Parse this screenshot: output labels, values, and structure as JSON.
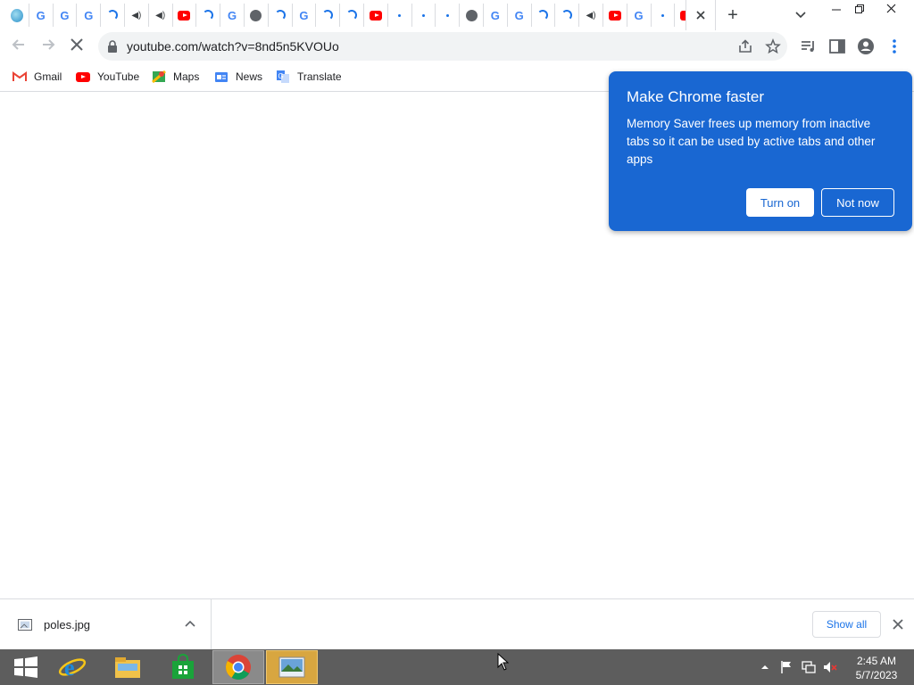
{
  "browser": {
    "tabs": [
      {
        "icon": "earth-favicon"
      },
      {
        "icon": "google-favicon"
      },
      {
        "icon": "google-favicon"
      },
      {
        "icon": "google-favicon"
      },
      {
        "icon": "loading-spinner"
      },
      {
        "icon": "speaker-icon"
      },
      {
        "icon": "speaker-icon"
      },
      {
        "icon": "youtube-favicon"
      },
      {
        "icon": "loading-spinner"
      },
      {
        "icon": "google-favicon"
      },
      {
        "icon": "globe-icon"
      },
      {
        "icon": "loading-spinner"
      },
      {
        "icon": "google-favicon"
      },
      {
        "icon": "loading-spinner"
      },
      {
        "icon": "loading-spinner"
      },
      {
        "icon": "youtube-favicon"
      },
      {
        "icon": "dot-icon"
      },
      {
        "icon": "dot-icon"
      },
      {
        "icon": "dot-icon"
      },
      {
        "icon": "globe-icon"
      },
      {
        "icon": "google-favicon"
      },
      {
        "icon": "google-favicon"
      },
      {
        "icon": "loading-spinner"
      },
      {
        "icon": "loading-spinner"
      },
      {
        "icon": "speaker-icon"
      },
      {
        "icon": "youtube-favicon"
      },
      {
        "icon": "google-favicon"
      },
      {
        "icon": "dot-icon"
      },
      {
        "icon": "youtube-favicon"
      }
    ],
    "url": "youtube.com/watch?v=8nd5n5KVOUo",
    "bookmarks": [
      {
        "label": "Gmail",
        "icon": "gmail-icon"
      },
      {
        "label": "YouTube",
        "icon": "youtube-icon"
      },
      {
        "label": "Maps",
        "icon": "maps-icon"
      },
      {
        "label": "News",
        "icon": "news-icon"
      },
      {
        "label": "Translate",
        "icon": "translate-icon"
      }
    ]
  },
  "popup": {
    "title": "Make Chrome faster",
    "body": "Memory Saver frees up memory from inactive tabs so it can be used by active tabs and other apps",
    "turn_on": "Turn on",
    "not_now": "Not now"
  },
  "downloads": {
    "file_name": "poles.jpg",
    "show_all": "Show all"
  },
  "taskbar": {
    "time": "2:45 AM",
    "date": "5/7/2023"
  },
  "colors": {
    "popup_bg": "#1967d2",
    "accent": "#1a73e8",
    "taskbar": "#5d5d5d"
  }
}
